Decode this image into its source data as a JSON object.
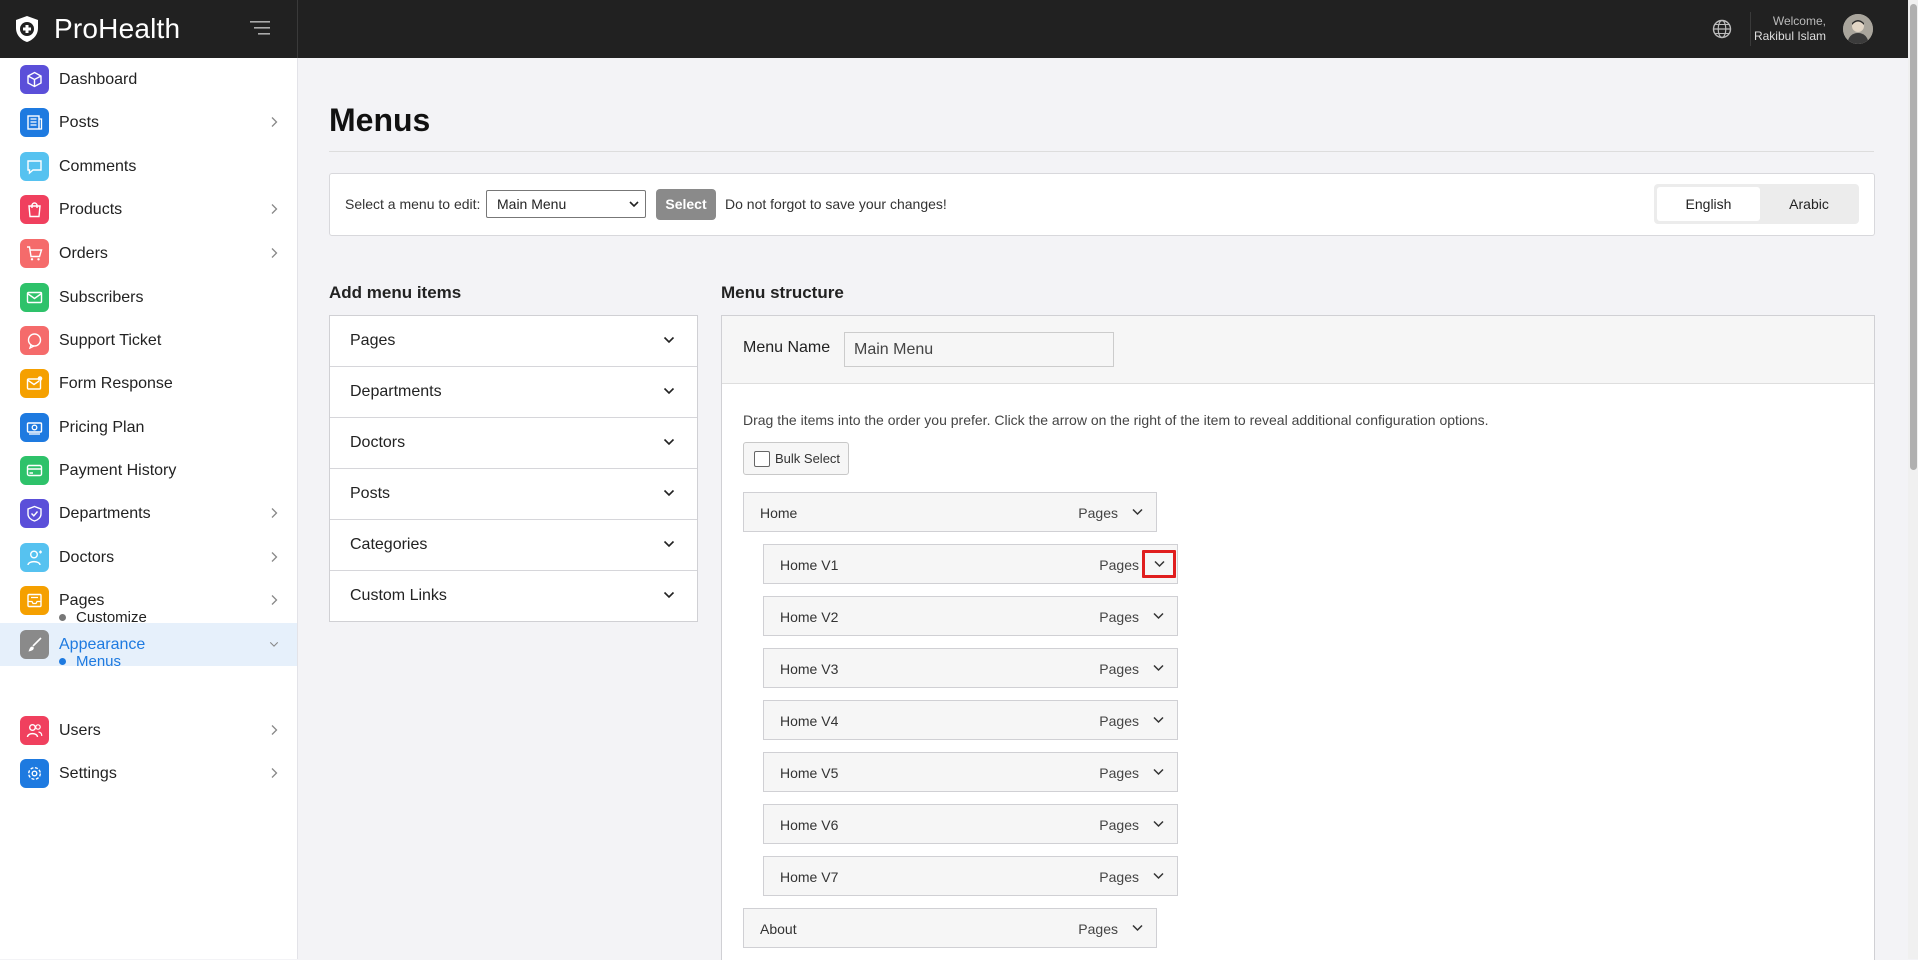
{
  "app": {
    "name": "ProHealth"
  },
  "header": {
    "welcome": "Welcome,",
    "user": "Rakibul Islam"
  },
  "sidebar": {
    "items": [
      {
        "label": "Dashboard",
        "icon": "cube-icon",
        "color": "#5b4fd9",
        "chevron": false
      },
      {
        "label": "Posts",
        "icon": "newspaper-icon",
        "color": "#1e7ae0",
        "chevron": true
      },
      {
        "label": "Comments",
        "icon": "chat-icon",
        "color": "#56c2f0",
        "chevron": false
      },
      {
        "label": "Products",
        "icon": "bag-icon",
        "color": "#f0405e",
        "chevron": true
      },
      {
        "label": "Orders",
        "icon": "cart-icon",
        "color": "#f56b6b",
        "chevron": true
      },
      {
        "label": "Subscribers",
        "icon": "mail-icon",
        "color": "#2ec26a",
        "chevron": false
      },
      {
        "label": "Support Ticket",
        "icon": "support-icon",
        "color": "#f56b6b",
        "chevron": false
      },
      {
        "label": "Form Response",
        "icon": "mail-notify-icon",
        "color": "#f5a000",
        "chevron": false
      },
      {
        "label": "Pricing Plan",
        "icon": "money-icon",
        "color": "#1e7ae0",
        "chevron": false
      },
      {
        "label": "Payment History",
        "icon": "card-icon",
        "color": "#2ec26a",
        "chevron": false
      },
      {
        "label": "Departments",
        "icon": "shield-icon",
        "color": "#5b4fd9",
        "chevron": true
      },
      {
        "label": "Doctors",
        "icon": "user-icon",
        "color": "#56c2f0",
        "chevron": true
      },
      {
        "label": "Pages",
        "icon": "inbox-icon",
        "color": "#f5a000",
        "chevron": true
      },
      {
        "label": "Appearance",
        "icon": "brush-icon",
        "color": "#8a8a8a",
        "chevron": true,
        "active": true
      },
      {
        "label": "Users",
        "icon": "users-icon",
        "color": "#f0405e",
        "chevron": true
      },
      {
        "label": "Settings",
        "icon": "gear-icon",
        "color": "#1e7ae0",
        "chevron": true
      }
    ],
    "subitems": [
      {
        "label": "Customize"
      },
      {
        "label": "Menus",
        "active": true
      }
    ]
  },
  "main": {
    "title": "Menus",
    "select_bar": {
      "label": "Select a menu to edit:",
      "selected": "Main Menu",
      "button": "Select",
      "hint": "Do not forgot to save your changes!"
    },
    "languages": [
      "English",
      "Arabic"
    ],
    "add_items": {
      "title": "Add menu items",
      "sections": [
        "Pages",
        "Departments",
        "Doctors",
        "Posts",
        "Categories",
        "Custom Links"
      ]
    },
    "structure": {
      "title": "Menu structure",
      "name_label": "Menu Name",
      "name_value": "Main Menu",
      "instructions": "Drag the items into the order you prefer. Click the arrow on the right of the item to reveal additional configuration options.",
      "bulk_select": "Bulk Select",
      "items": [
        {
          "title": "Home",
          "type": "Pages",
          "level": 0
        },
        {
          "title": "Home V1",
          "type": "Pages",
          "level": 1,
          "highlight": true
        },
        {
          "title": "Home V2",
          "type": "Pages",
          "level": 1
        },
        {
          "title": "Home V3",
          "type": "Pages",
          "level": 1
        },
        {
          "title": "Home V4",
          "type": "Pages",
          "level": 1
        },
        {
          "title": "Home V5",
          "type": "Pages",
          "level": 1
        },
        {
          "title": "Home V6",
          "type": "Pages",
          "level": 1
        },
        {
          "title": "Home V7",
          "type": "Pages",
          "level": 1
        },
        {
          "title": "About",
          "type": "Pages",
          "level": 0
        }
      ]
    }
  }
}
